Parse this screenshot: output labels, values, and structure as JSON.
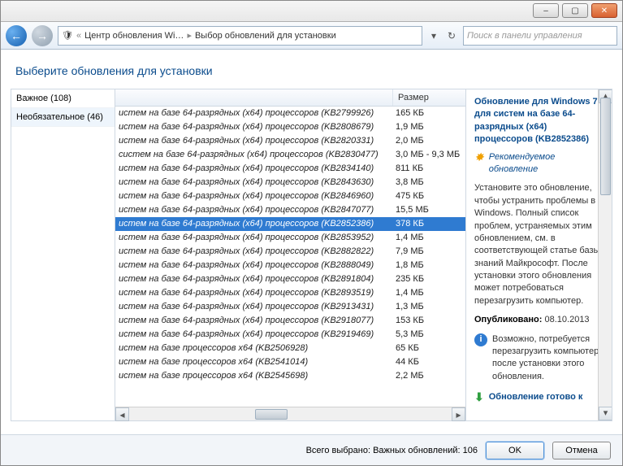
{
  "titlebar": {
    "min": "–",
    "max": "▢",
    "close": "✕"
  },
  "toolbar": {
    "back": "←",
    "fwd": "→",
    "breadcrumb1": "Центр обновления Wi…",
    "breadcrumb2": "Выбор обновлений для установки",
    "search_placeholder": "Поиск в панели управления"
  },
  "heading": "Выберите обновления для установки",
  "sidebar": {
    "items": [
      {
        "label": "Важное (108)"
      },
      {
        "label": "Необязательное (46)"
      }
    ]
  },
  "columns": {
    "name": "",
    "size": "Размер"
  },
  "rows": [
    {
      "name": "истем на базе 64-разрядных (x64) процессоров (KB2799926)",
      "size": "165 КБ"
    },
    {
      "name": "истем на базе 64-разрядных (x64) процессоров (KB2808679)",
      "size": "1,9 МБ"
    },
    {
      "name": "истем на базе 64-разрядных (x64) процессоров (KB2820331)",
      "size": "2,0 МБ"
    },
    {
      "name": "систем на базе 64-разрядных (x64) процессоров (KB2830477)",
      "size": "3,0 МБ - 9,3 МБ"
    },
    {
      "name": "истем на базе 64-разрядных (x64) процессоров (KB2834140)",
      "size": "811 КБ"
    },
    {
      "name": "истем на базе 64-разрядных (x64) процессоров (KB2843630)",
      "size": "3,8 МБ"
    },
    {
      "name": "истем на базе 64-разрядных (x64) процессоров (KB2846960)",
      "size": "475 КБ"
    },
    {
      "name": "истем на базе 64-разрядных (x64) процессоров (KB2847077)",
      "size": "15,5 МБ"
    },
    {
      "name": "истем на базе 64-разрядных (x64) процессоров (KB2852386)",
      "size": "378 КБ",
      "selected": true
    },
    {
      "name": "истем на базе 64-разрядных (x64) процессоров (KB2853952)",
      "size": "1,4 МБ"
    },
    {
      "name": "истем на базе 64-разрядных (x64) процессоров (KB2882822)",
      "size": "7,9 МБ"
    },
    {
      "name": "истем на базе 64-разрядных (x64) процессоров (KB2888049)",
      "size": "1,8 МБ"
    },
    {
      "name": "истем на базе 64-разрядных (x64) процессоров (KB2891804)",
      "size": "235 КБ"
    },
    {
      "name": "истем на базе 64-разрядных (x64) процессоров (KB2893519)",
      "size": "1,4 МБ"
    },
    {
      "name": "истем на базе 64-разрядных (x64) процессоров (KB2913431)",
      "size": "1,3 МБ"
    },
    {
      "name": "истем на базе 64-разрядных (x64) процессоров (KB2918077)",
      "size": "153 КБ"
    },
    {
      "name": "истем на базе 64-разрядных (x64) процессоров (KB2919469)",
      "size": "5,3 МБ"
    },
    {
      "name": "истем на базе процессоров x64 (KB2506928)",
      "size": "65 КБ"
    },
    {
      "name": "истем на базе процессоров x64 (KB2541014)",
      "size": "44 КБ"
    },
    {
      "name": "истем на базе процессоров x64 (KB2545698)",
      "size": "2,2 МБ"
    }
  ],
  "details": {
    "title": "Обновление для Windows 7 для систем на базе 64-разрядных (x64) процессоров (KB2852386)",
    "reco": "Рекомендуемое обновление",
    "desc": "Установите это обновление, чтобы устранить проблемы в Windows. Полный список проблем, устраняемых этим обновлением, см. в соответствующей статье базы знаний Майкрософт. После установки этого обновления может потребоваться перезагрузить компьютер.",
    "pub_label": "Опубликовано:",
    "pub_date": "08.10.2013",
    "restart": "Возможно, потребуется перезагрузить компьютер после установки этого обновления.",
    "ready": "Обновление готово к"
  },
  "footer": {
    "summary": "Всего выбрано: Важных обновлений: 106",
    "ok": "OK",
    "cancel": "Отмена"
  }
}
